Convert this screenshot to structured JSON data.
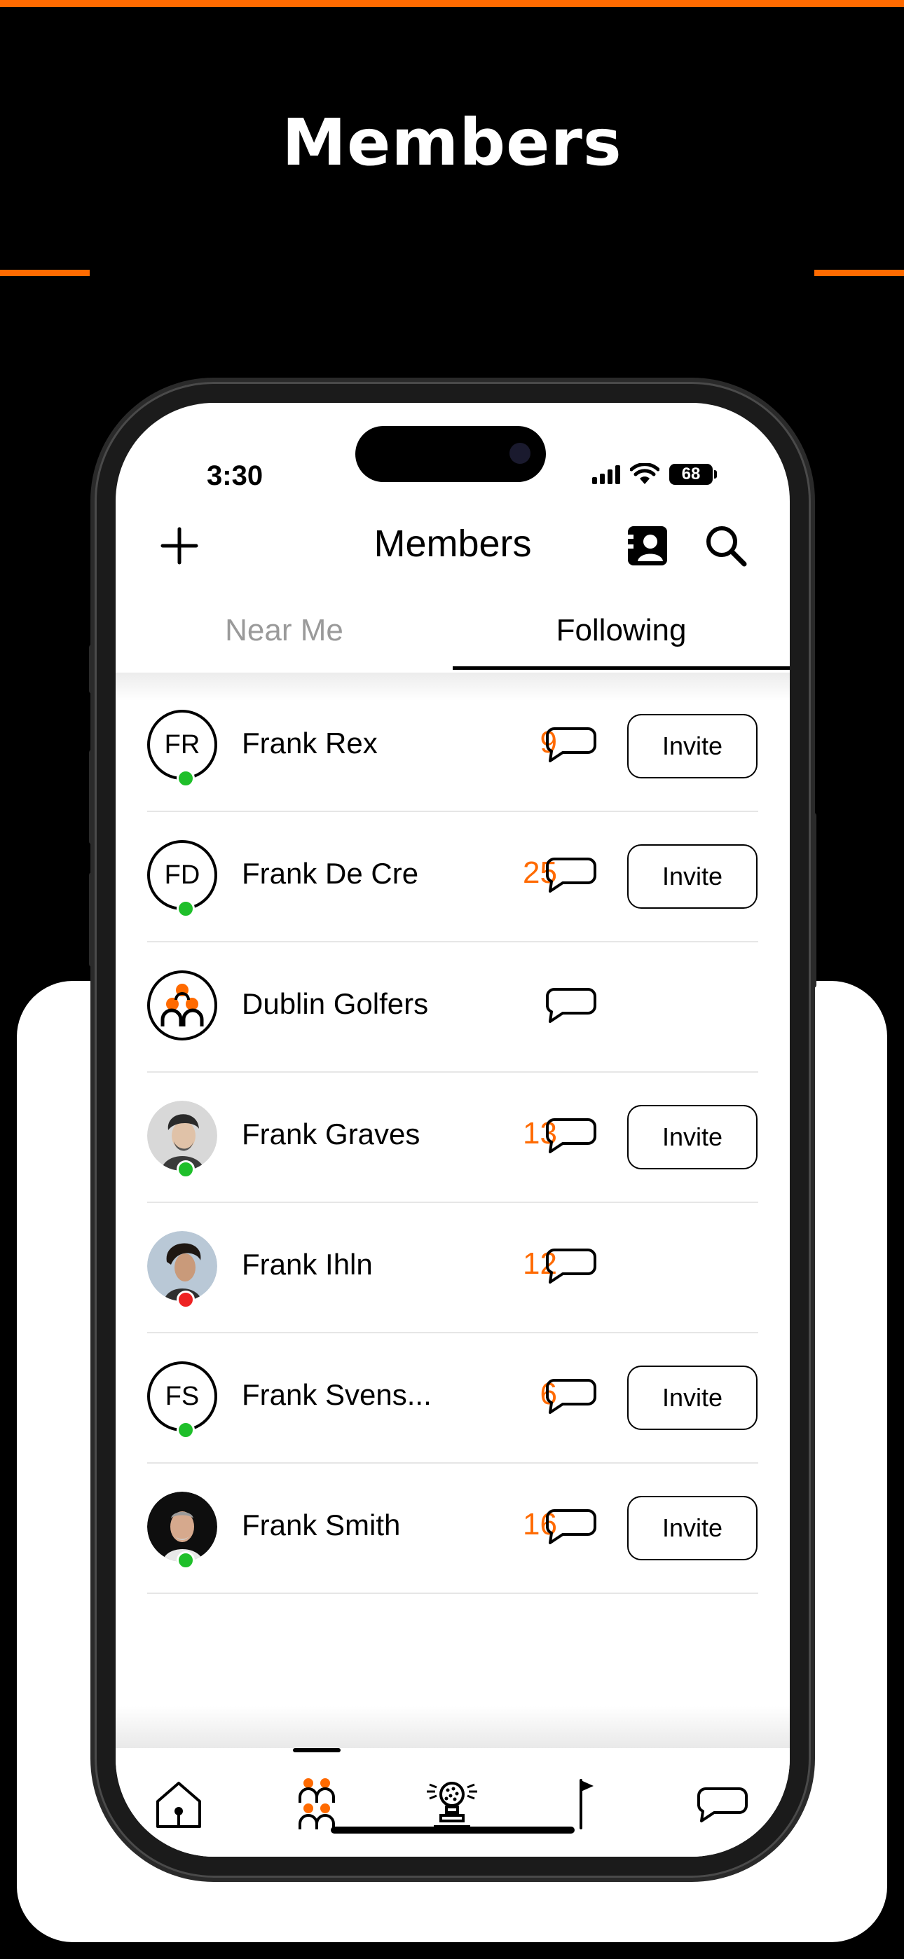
{
  "promo": {
    "title": "Members"
  },
  "colors": {
    "accent": "#ff6a00",
    "online": "#1fbf2a",
    "offline": "#ee2222"
  },
  "status_bar": {
    "time": "3:30",
    "battery": "68",
    "icons": [
      "signal-icon",
      "wifi-icon",
      "battery-icon"
    ]
  },
  "header": {
    "title": "Members",
    "left_icon": "plus-icon",
    "right_icons": [
      "contacts-icon",
      "search-icon"
    ]
  },
  "tabs": [
    {
      "label": "Near Me",
      "selected": false
    },
    {
      "label": "Following",
      "selected": true
    }
  ],
  "members": [
    {
      "initials": "FR",
      "name": "Frank Rex",
      "count": "9",
      "status": "online",
      "invite": "Invite"
    },
    {
      "initials": "FD",
      "name": "Frank De Cre",
      "count": "25",
      "status": "online",
      "invite": "Invite"
    },
    {
      "initials": "",
      "name": "Dublin Golfers",
      "count": "",
      "status": "",
      "invite": ""
    },
    {
      "initials": "",
      "name": "Frank Graves",
      "count": "13",
      "status": "online",
      "invite": "Invite"
    },
    {
      "initials": "",
      "name": "Frank Ihln",
      "count": "12",
      "status": "offline",
      "invite": ""
    },
    {
      "initials": "FS",
      "name": "Frank Svens...",
      "count": "6",
      "status": "online",
      "invite": "Invite"
    },
    {
      "initials": "",
      "name": "Frank Smith",
      "count": "16",
      "status": "online",
      "invite": "Invite"
    }
  ],
  "bottom_nav": [
    {
      "icon": "home-icon",
      "selected": false
    },
    {
      "icon": "members-icon",
      "selected": true
    },
    {
      "icon": "trophy-icon",
      "selected": false
    },
    {
      "icon": "flag-icon",
      "selected": false
    },
    {
      "icon": "chat-icon",
      "selected": false
    }
  ]
}
